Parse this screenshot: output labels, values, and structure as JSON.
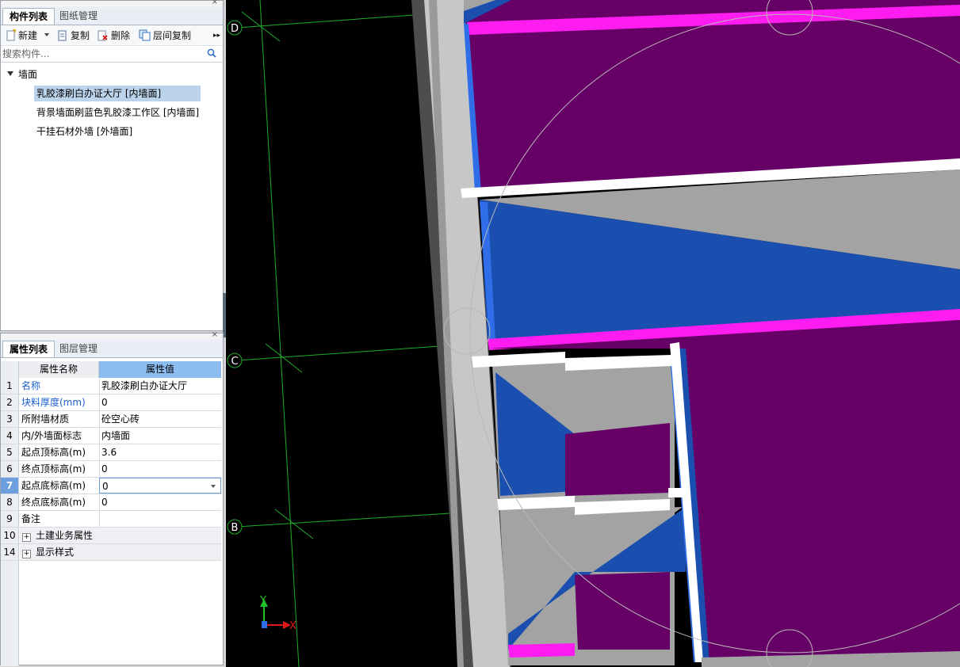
{
  "component_panel": {
    "close_glyph": "×",
    "tabs": [
      {
        "label": "构件列表",
        "active": true
      },
      {
        "label": "图纸管理",
        "active": false
      }
    ],
    "toolbar": {
      "new_label": "新建",
      "copy_label": "复制",
      "delete_label": "删除",
      "floor_copy_label": "层间复制",
      "more_glyph": "▸▸"
    },
    "search": {
      "placeholder": "搜索构件..."
    },
    "tree": {
      "root_label": "墙面",
      "items": [
        {
          "label": "乳胶漆刷白办证大厅 [内墙面]",
          "selected": true
        },
        {
          "label": "背景墙面刷蓝色乳胶漆工作区 [内墙面]",
          "selected": false
        },
        {
          "label": "干挂石材外墙 [外墙面]",
          "selected": false
        }
      ]
    }
  },
  "property_panel": {
    "close_glyph": "×",
    "tabs": [
      {
        "label": "属性列表",
        "active": true
      },
      {
        "label": "图层管理",
        "active": false
      }
    ],
    "headers": {
      "name": "属性名称",
      "value": "属性值"
    },
    "rows": [
      {
        "num": "1",
        "name": "名称",
        "value": "乳胶漆刷白办证大厅",
        "blue": true
      },
      {
        "num": "2",
        "name": "块料厚度(mm)",
        "value": "0",
        "blue": true
      },
      {
        "num": "3",
        "name": "所附墙材质",
        "value": "砼空心砖",
        "blue": false
      },
      {
        "num": "4",
        "name": "内/外墙面标志",
        "value": "内墙面",
        "blue": false
      },
      {
        "num": "5",
        "name": "起点顶标高(m)",
        "value": "3.6",
        "blue": false
      },
      {
        "num": "6",
        "name": "终点顶标高(m)",
        "value": "0",
        "blue": false
      },
      {
        "num": "7",
        "name": "起点底标高(m)",
        "value": "0",
        "blue": false,
        "editing": true
      },
      {
        "num": "8",
        "name": "终点底标高(m)",
        "value": "0",
        "blue": false
      },
      {
        "num": "9",
        "name": "备注",
        "value": "",
        "blue": false
      },
      {
        "num": "10",
        "name": "土建业务属性",
        "value": "",
        "group": true
      },
      {
        "num": "14",
        "name": "显示样式",
        "value": "",
        "group": true
      }
    ]
  },
  "viewport": {
    "axis_labels": [
      "D",
      "C",
      "B"
    ],
    "coordinate_axes": {
      "y": "Y",
      "x": "X"
    },
    "colors": {
      "background": "#000000",
      "grid_line": "#1fae2c",
      "wall_gray": "#a3a3a3",
      "wall_light": "#c7c7c7",
      "wall_dark": "#4d4d4d",
      "blue_face": "#1a4fb0",
      "bright_blue": "#2f6ee8",
      "magenta_edge": "#ff1cf0",
      "purple_face": "#660066",
      "white_beam": "#ffffff",
      "orbit_circle": "#b8b8b8"
    }
  }
}
